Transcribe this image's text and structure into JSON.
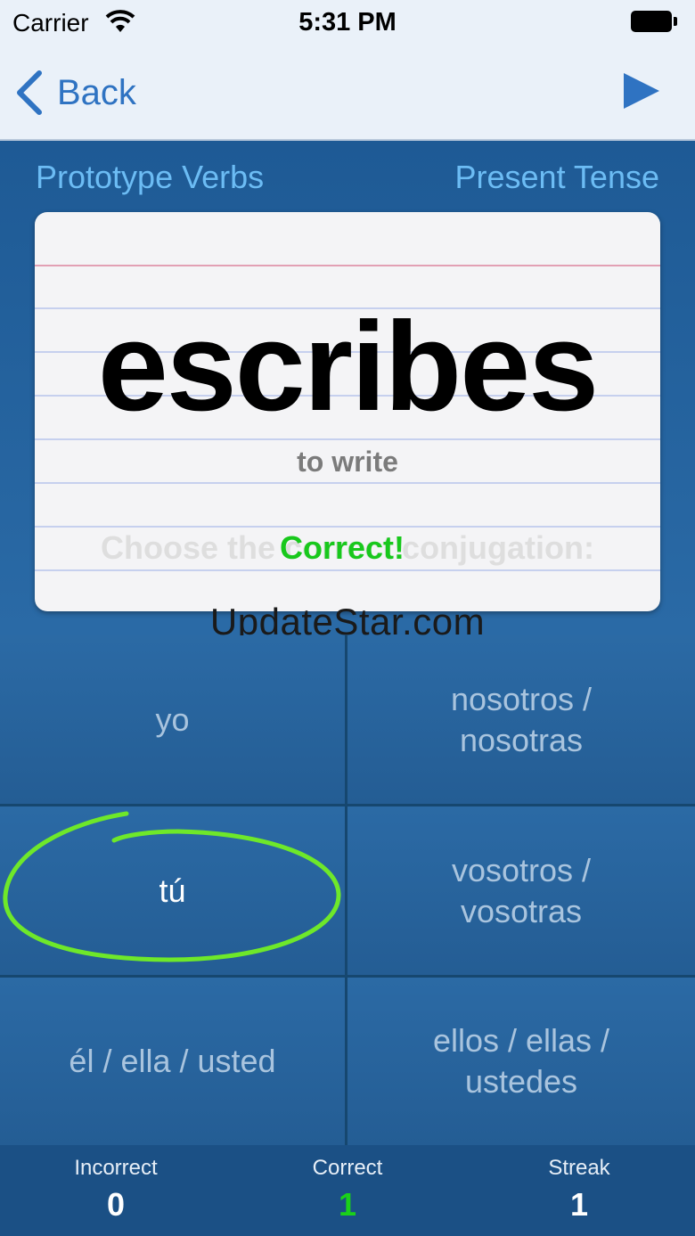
{
  "status_bar": {
    "carrier": "Carrier",
    "time": "5:31 PM",
    "icons": [
      "wifi-icon",
      "battery-icon"
    ]
  },
  "nav": {
    "back_label": "Back",
    "back_icon": "chevron-left-icon",
    "play_icon": "play-icon",
    "accent_color": "#2f73c2"
  },
  "header": {
    "deck": "Prototype Verbs",
    "tense": "Present Tense",
    "label_color": "#6cbcf4"
  },
  "card": {
    "word": "escribes",
    "translation": "to write",
    "prompt": "Choose the correct conjugation:",
    "feedback": "Correct!",
    "feedback_color": "#18c81c"
  },
  "watermark": "UpdateStar.com",
  "answers": [
    {
      "label": "yo",
      "selected": false
    },
    {
      "label": "nosotros /\nnosotras",
      "selected": false
    },
    {
      "label": "tú",
      "selected": true
    },
    {
      "label": "vosotros /\nvosotras",
      "selected": false
    },
    {
      "label": "él / ella / usted",
      "selected": false
    },
    {
      "label": "ellos / ellas /\nustedes",
      "selected": false
    }
  ],
  "annotation": {
    "type": "circle",
    "target": "tú",
    "color": "#6ee82a"
  },
  "scores": {
    "incorrect": {
      "label": "Incorrect",
      "value": "0"
    },
    "correct": {
      "label": "Correct",
      "value": "1"
    },
    "streak": {
      "label": "Streak",
      "value": "1"
    }
  }
}
